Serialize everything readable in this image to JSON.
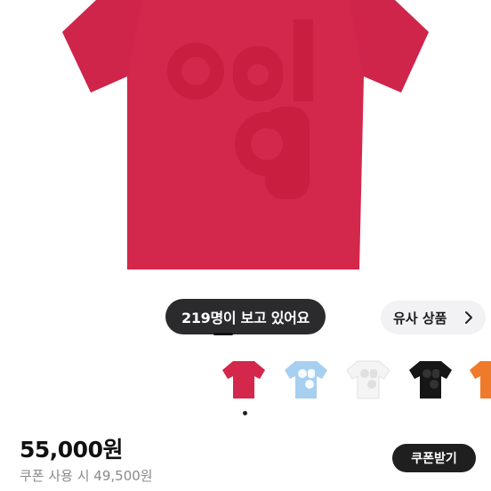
{
  "product": {
    "viewers_label": "219명이 보고 있어요",
    "similar_label": "유사 상품",
    "price": "55,000원",
    "coupon_price": "쿠폰 사용 시 49,500원",
    "coupon_button": "쿠폰받기"
  },
  "colors": {
    "shirt_red": "#d3274b",
    "shirt_red_dark": "#c11f40",
    "print_red": "#c81d3f",
    "sky": "#a6cff0",
    "white_shirt": "#f4f4f4",
    "black_shirt": "#161616",
    "orange_shirt": "#ef7a2a"
  },
  "swatches": [
    {
      "name": "red",
      "color": "#d3274b"
    },
    {
      "name": "sky-blue",
      "color": "#a6cff0"
    },
    {
      "name": "white",
      "color": "#f4f4f4"
    },
    {
      "name": "black",
      "color": "#161616"
    },
    {
      "name": "orange",
      "color": "#ef7a2a"
    }
  ],
  "icons": {
    "chevron": "chevron-right-icon"
  }
}
